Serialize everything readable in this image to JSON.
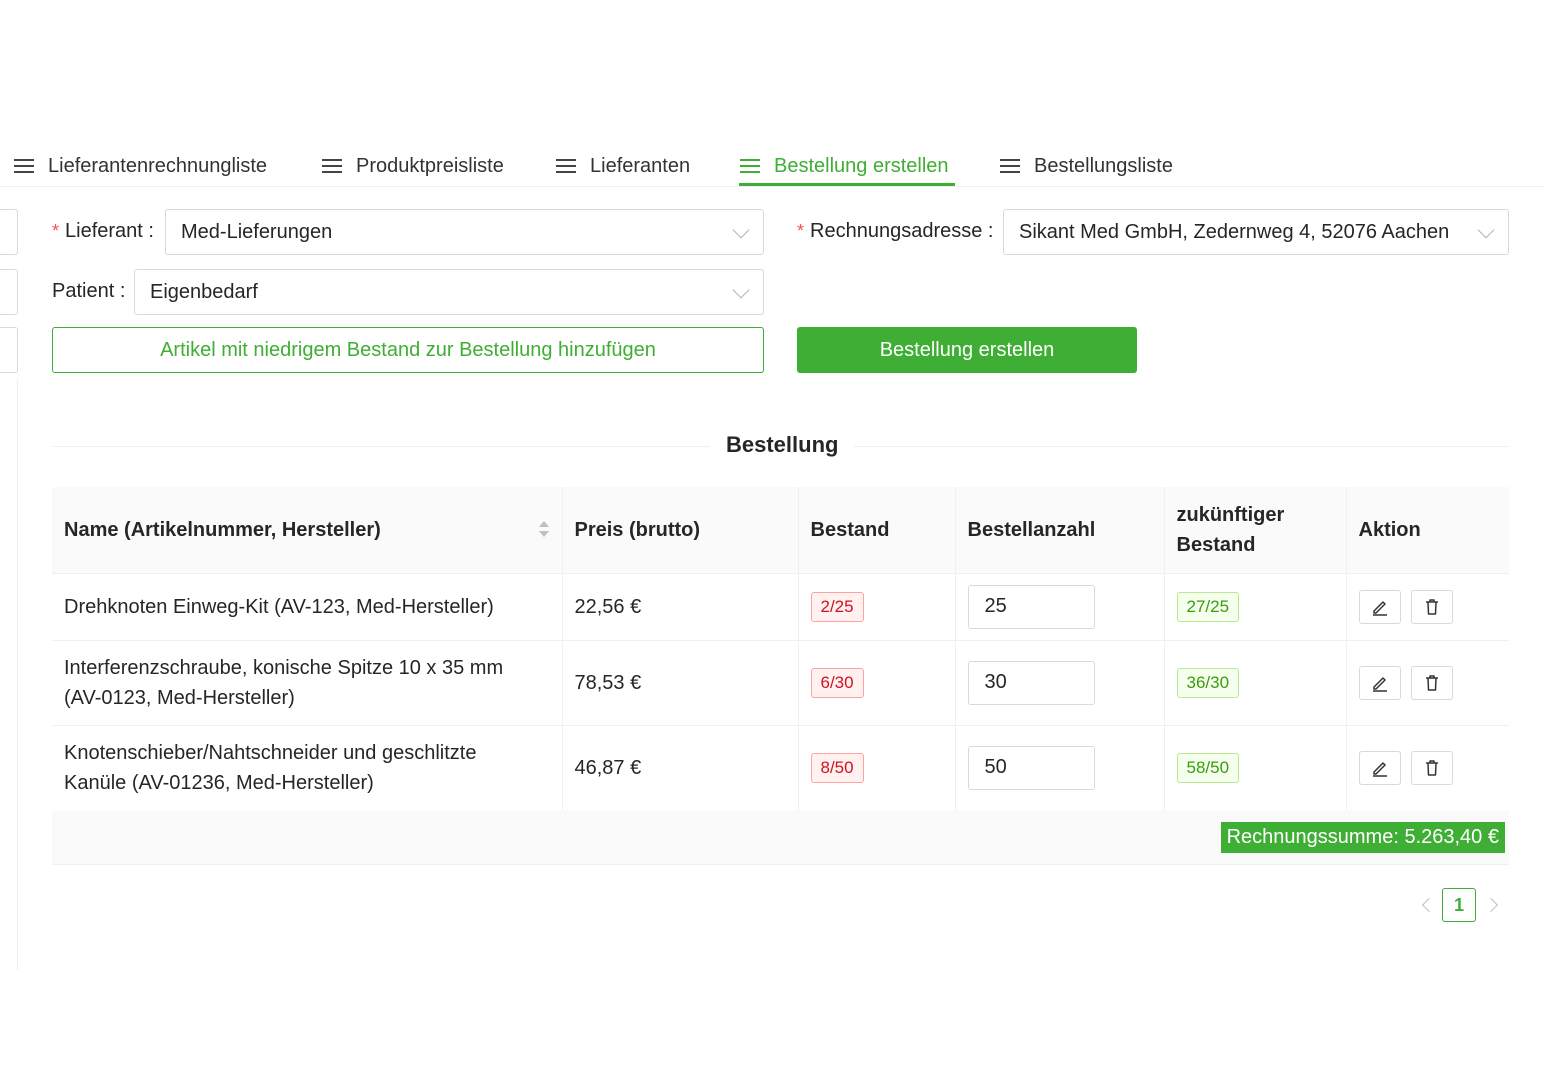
{
  "tabs": [
    {
      "label": "Lieferantenrechnungliste"
    },
    {
      "label": "Produktpreisliste"
    },
    {
      "label": "Lieferanten"
    },
    {
      "label": "Bestellung erstellen",
      "active": true
    },
    {
      "label": "Bestellungsliste"
    }
  ],
  "form": {
    "supplier_label": "Lieferant",
    "supplier_value": "Med-Lieferungen",
    "billing_label": "Rechnungsadresse",
    "billing_value": "Sikant Med GmbH, Zedernweg 4, 52076 Aachen",
    "patient_label": "Patient",
    "patient_value": "Eigenbedarf",
    "low_stock_button": "Artikel mit niedrigem Bestand zur Bestellung hinzufügen",
    "create_order_button": "Bestellung erstellen"
  },
  "order": {
    "title": "Bestellung",
    "columns": {
      "name": "Name (Artikelnummer, Hersteller)",
      "price": "Preis (brutto)",
      "stock": "Bestand",
      "quantity": "Bestellanzahl",
      "future_stock_1": "zukünftiger",
      "future_stock_2": "Bestand",
      "action": "Aktion"
    },
    "rows": [
      {
        "name_1": "Drehknoten Einweg-Kit (AV-123, Med-Hersteller)",
        "name_2": "",
        "price": "22,56 €",
        "stock": "2/25",
        "quantity": "25",
        "future_stock": "27/25"
      },
      {
        "name_1": "Interferenzschraube, konische Spitze 10 x 35 mm",
        "name_2": "(AV-0123, Med-Hersteller)",
        "price": "78,53 €",
        "stock": "6/30",
        "quantity": "30",
        "future_stock": "36/30"
      },
      {
        "name_1": "Knotenschieber/Nahtschneider und geschlitzte",
        "name_2": "Kanüle (AV-01236, Med-Hersteller)",
        "price": "46,87 €",
        "stock": "8/50",
        "quantity": "50",
        "future_stock": "58/50"
      }
    ],
    "total": "Rechnungssumme: 5.263,40 €"
  },
  "pagination": {
    "current": "1"
  },
  "colors": {
    "accent": "#3fae34",
    "danger": "#cf1322",
    "required": "#ff4d4f"
  },
  "icons": [
    "list-icon",
    "chevron-down-icon",
    "sort-icon",
    "edit-icon",
    "delete-icon",
    "chevron-left-icon",
    "chevron-right-icon"
  ]
}
